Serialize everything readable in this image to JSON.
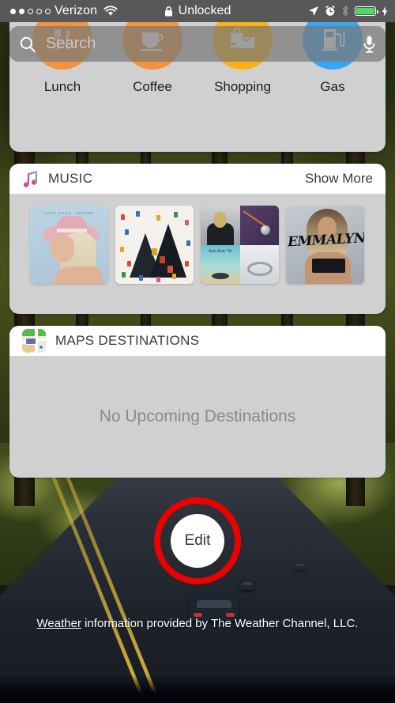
{
  "status_bar": {
    "signal_dots": [
      true,
      true,
      false,
      false,
      false
    ],
    "carrier": "Verizon",
    "wifi_icon": "wifi-icon",
    "lock_icon": "lock-icon",
    "lock_label": "Unlocked",
    "location_icon": "location-arrow-icon",
    "alarm_icon": "alarm-clock-icon",
    "bluetooth_icon": "bluetooth-icon",
    "battery_icon": "battery-icon",
    "battery_color": "#4cd964",
    "charging_icon": "lightning-bolt-icon"
  },
  "search": {
    "placeholder": "Search",
    "search_icon": "search-icon",
    "mic_icon": "microphone-icon"
  },
  "quick_actions": [
    {
      "label": "Lunch",
      "icon": "fork-knife-icon",
      "color": "#f3923f"
    },
    {
      "label": "Coffee",
      "icon": "coffee-cup-icon",
      "color": "#f3923f"
    },
    {
      "label": "Shopping",
      "icon": "shopping-bags-icon",
      "color": "#f9b115"
    },
    {
      "label": "Gas",
      "icon": "gas-pump-icon",
      "color": "#36a6f2"
    }
  ],
  "music_widget": {
    "icon": "music-note-icon",
    "title": "MUSIC",
    "show_more": "Show More",
    "albums": [
      {
        "name": "joanne-album-art",
        "artist": "LADY GAGA",
        "title": "JOANNE"
      },
      {
        "name": "mountains-album-art"
      },
      {
        "name": "playlist-collage-art",
        "tile_caption": "Suis Avec Toi"
      },
      {
        "name": "emmalyn-album-art",
        "title": "EMMALYN"
      }
    ]
  },
  "maps_widget": {
    "icon": "maps-icon",
    "shield_number": "280",
    "title": "MAPS DESTINATIONS",
    "empty_message": "No Upcoming Destinations"
  },
  "edit_button": {
    "label": "Edit",
    "highlight_color": "#ee0000"
  },
  "weather_note": {
    "link_text": "Weather",
    "rest_text": " information provided by The Weather Channel, LLC."
  }
}
